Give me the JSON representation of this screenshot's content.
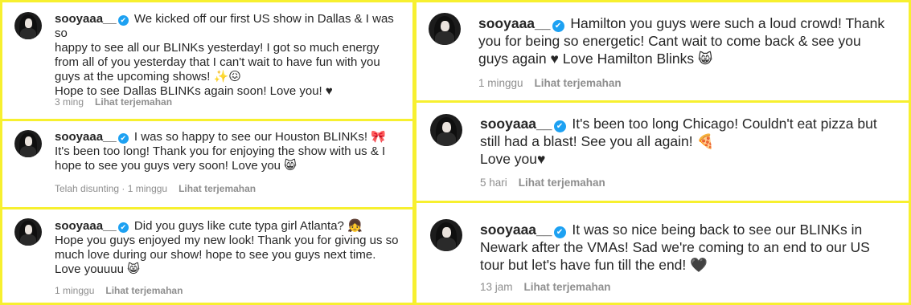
{
  "username": "sooyaaa__",
  "verified_icon": "✔",
  "left_comments": [
    {
      "lines": [
        "We kicked off our first US show in Dallas & I was so",
        "happy to see all our BLINKs yesterday! I got so much energy",
        "from all of you yesterday that I can't wait to have fun with you",
        "guys at the upcoming shows! ✨😖",
        "Hope to see Dallas BLINKs again soon! Love you! ♥"
      ],
      "time": "3 ming",
      "action": "Lihat terjemahan"
    },
    {
      "lines": [
        "I was so happy to see our Houston BLINKs! 🎀",
        "It's been too long! Thank you for enjoying the show with us & I",
        "hope to see you guys very soon! Love you 😸"
      ],
      "time": "Telah disunting · 1 minggu",
      "action": "Lihat terjemahan"
    },
    {
      "lines": [
        "Did you guys like cute typa girl Atlanta? 👧",
        "Hope you guys enjoyed my new look! Thank you for giving us so",
        "much love during our show! hope to see you guys next time.",
        "Love youuuu 😸"
      ],
      "time": "1 minggu",
      "action": "Lihat terjemahan"
    }
  ],
  "right_comments": [
    {
      "lines": [
        "Hamilton you guys were such a loud crowd! Thank",
        "you for being so energetic! Cant wait to come back & see you",
        "guys again ♥ Love Hamilton Blinks 😸"
      ],
      "time": "1 minggu",
      "action": "Lihat terjemahan"
    },
    {
      "lines": [
        "It's been too long Chicago! Couldn't eat pizza but",
        "still had a blast! See you all again! 🍕",
        "Love you♥"
      ],
      "time": "5 hari",
      "action": "Lihat terjemahan"
    },
    {
      "lines": [
        "It was so nice being back to see our BLINKs in",
        "Newark after the VMAs! Sad we're coming to an end to our US",
        "tour but let's have fun till the end! 🖤"
      ],
      "time": "13 jam",
      "action": "Lihat terjemahan"
    }
  ],
  "colors": {
    "border": "#f7f02f",
    "verified": "#1da1f2",
    "meta": "#8e8e8e",
    "text": "#262626"
  }
}
